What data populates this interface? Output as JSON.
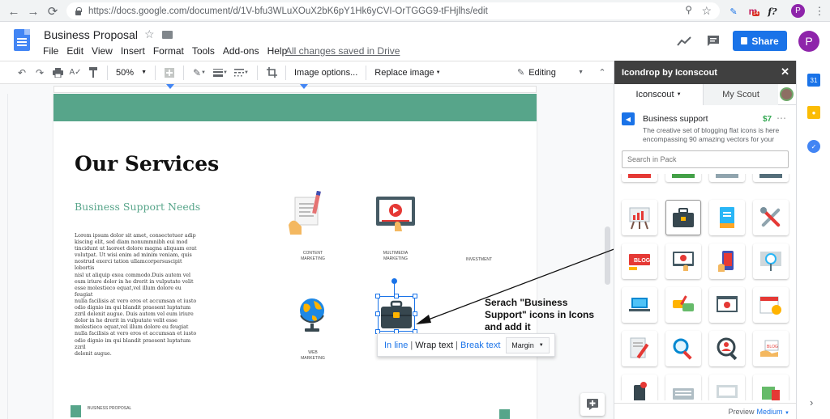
{
  "browser": {
    "url": "https://docs.google.com/document/d/1V-bfu3WLuXOuX2bK6pY1Hk6yCVI-OrTGGG9-tFHjlhs/edit",
    "ext_badge": "14",
    "ext_text": "f?",
    "profile_initial": "P"
  },
  "docs": {
    "title": "Business Proposal",
    "menu": [
      "File",
      "Edit",
      "View",
      "Insert",
      "Format",
      "Tools",
      "Add-ons",
      "Help"
    ],
    "saved_status": "All changes saved in Drive",
    "share_label": "Share",
    "avatar_initial": "P"
  },
  "toolbar": {
    "zoom": "50%",
    "image_options": "Image options...",
    "replace_image": "Replace image",
    "mode": "Editing"
  },
  "page": {
    "title": "Our Services",
    "subtitle": "Business Support Needs",
    "body": "Lorem ipsum dolor sit amet, consectetuer adip\nkiscing elit, sed diam nonummnibh eui mod\ntincidunt ut laoreet dolore magna aliquam erat\nvolutpat. Ut wisi enim ad minim veniam, quis\nnostrud exerci tation ullamcorpersuscipit lobortis\nnisl ut aliquip exea commodo.Duis autem vel\neum iriure dolor in he drerit in vulputate velit\nesse molestieco equat,vel illum dolore eu feugiat\nnulla facilisis at vero eros et accumsan et iusto\nodio dignio im qui blandit praesent luptatum\nzzril delenit augue. Duis autem vel eum iriure\ndolor in he drerit in vulputate velit esse\nmolestieco equat,vel illum dolore eu feugiat\nnulla facilisis at vero eros et accumsan et iusto\nodio dignio im qui blandit praesent luptatum\nzzril\n delenit augue.",
    "services": [
      {
        "line1": "CONTENT",
        "line2": "MARKETING"
      },
      {
        "line1": "MULTIMEDIA",
        "line2": "MARKETING"
      },
      {
        "line1": "INVESTMENT",
        "line2": ""
      },
      {
        "line1": "WEB",
        "line2": "MARKETING"
      }
    ],
    "footer": "BUSINESS PROPOSAL"
  },
  "image_popup": {
    "inline": "In line",
    "wrap": "Wrap text",
    "break": "Break text",
    "separator": "|",
    "margin": "Margin"
  },
  "annotation": "Serach \"Business Support\" icons in Icons and add it",
  "sidepanel": {
    "title": "Icondrop by Iconscout",
    "tab_active": "Iconscout",
    "tab_other": "My Scout",
    "pack_title": "Business support",
    "pack_price": "$7",
    "pack_desc": "The creative set of blogging flat icons is here encompassing 90 amazing vectors for your",
    "search_placeholder": "Search in Pack",
    "preview_label": "Preview",
    "preview_size": "Medium"
  },
  "colors": {
    "accent_green": "#57a58a",
    "docs_blue": "#1a73e8",
    "panel_header": "#404040",
    "price_green": "#34a853"
  }
}
